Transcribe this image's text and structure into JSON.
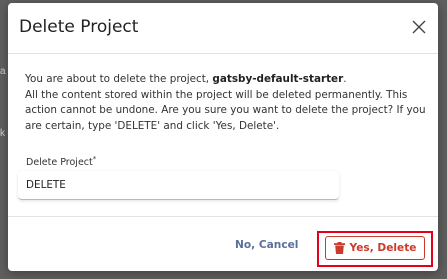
{
  "modal": {
    "title": "Delete Project",
    "message_prefix": "You are about to delete the project, ",
    "project_name": "gatsby-default-starter",
    "message_suffix": ".",
    "message_body": "All the content stored within the project will be deleted permanently. This action cannot be undone. Are you sure you want to delete the project? If you are certain, type 'DELETE' and click 'Yes, Delete'.",
    "field_label": "Delete Project",
    "field_required_mark": "*",
    "field_value": "DELETE",
    "cancel_label": "No, Cancel",
    "delete_label": "Yes, Delete"
  },
  "icons": {
    "close": "close-icon",
    "delete": "trash-icon"
  },
  "colors": {
    "danger": "#cc3a2c",
    "highlight": "#e4001b",
    "cancel_text": "#5a6f9b",
    "input_underline": "#b7b2d9"
  }
}
